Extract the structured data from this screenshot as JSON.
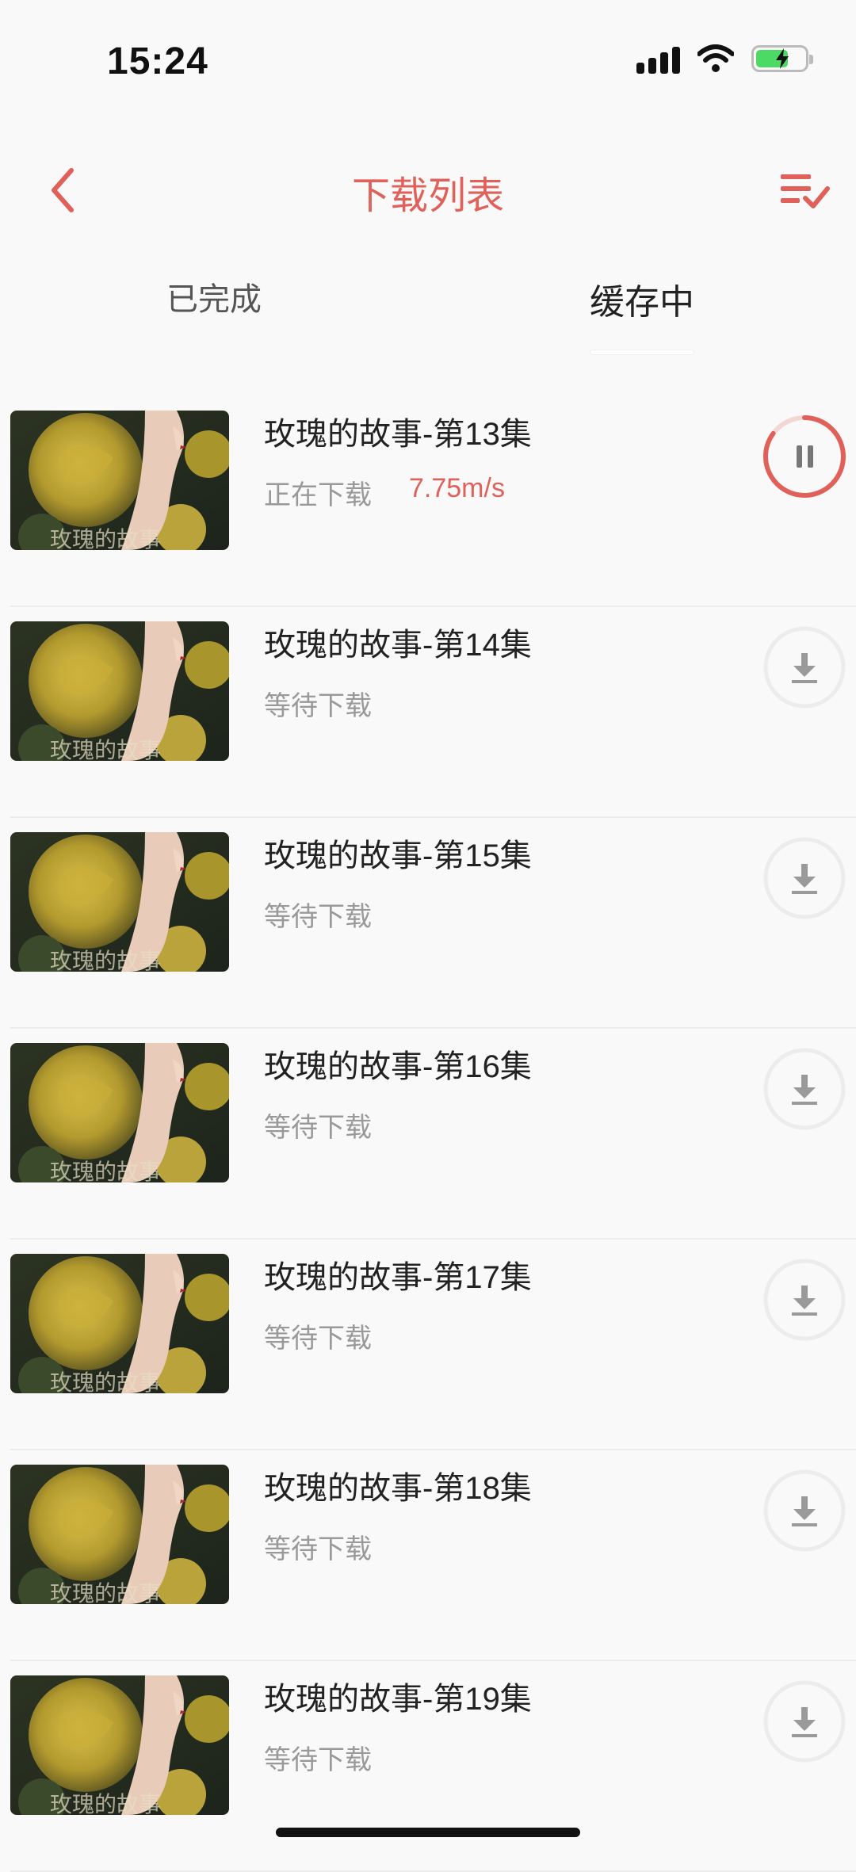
{
  "status_bar": {
    "time": "15:24"
  },
  "nav": {
    "title": "下载列表"
  },
  "tabs": {
    "completed": "已完成",
    "caching": "缓存中"
  },
  "colors": {
    "accent": "#e0605a",
    "muted": "#999999",
    "battery": "#4cd964"
  },
  "icons": [
    "back-arrow-icon",
    "list-check-icon",
    "pause-icon",
    "download-icon"
  ],
  "thumbnail_caption": "玫瑰的故事",
  "items": [
    {
      "title": "玫瑰的故事-第13集",
      "status": "正在下载",
      "speed": "7.75m/s",
      "state": "downloading",
      "progress": 0.85
    },
    {
      "title": "玫瑰的故事-第14集",
      "status": "等待下载",
      "speed": "",
      "state": "waiting"
    },
    {
      "title": "玫瑰的故事-第15集",
      "status": "等待下载",
      "speed": "",
      "state": "waiting"
    },
    {
      "title": "玫瑰的故事-第16集",
      "status": "等待下载",
      "speed": "",
      "state": "waiting"
    },
    {
      "title": "玫瑰的故事-第17集",
      "status": "等待下载",
      "speed": "",
      "state": "waiting"
    },
    {
      "title": "玫瑰的故事-第18集",
      "status": "等待下载",
      "speed": "",
      "state": "waiting"
    },
    {
      "title": "玫瑰的故事-第19集",
      "status": "等待下载",
      "speed": "",
      "state": "waiting"
    }
  ]
}
